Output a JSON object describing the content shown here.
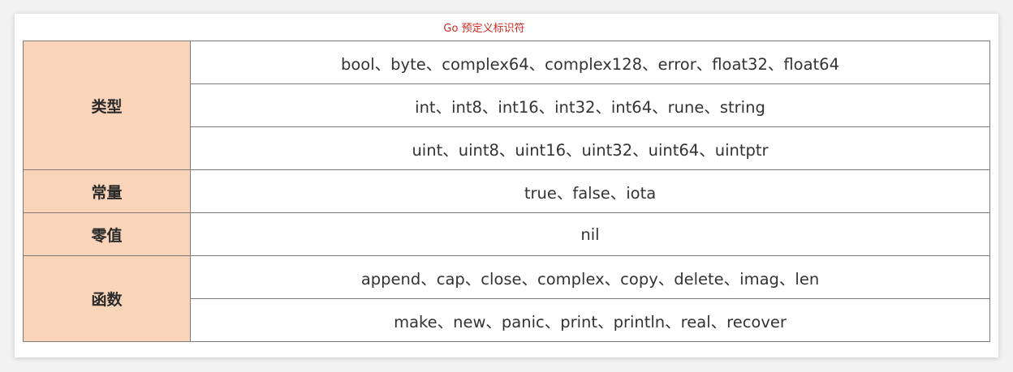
{
  "caption": "Go 预定义标识符",
  "table": {
    "groups": [
      {
        "category": "类型",
        "rows": [
          "bool、byte、complex64、complex128、error、float32、float64",
          "int、int8、int16、int32、int64、rune、string",
          "uint、uint8、uint16、uint32、uint64、uintptr"
        ]
      },
      {
        "category": "常量",
        "rows": [
          "true、false、iota"
        ]
      },
      {
        "category": "零值",
        "rows": [
          "nil"
        ]
      },
      {
        "category": "函数",
        "rows": [
          "append、cap、close、complex、copy、delete、imag、len",
          "make、new、panic、print、println、real、recover"
        ]
      }
    ]
  },
  "colors": {
    "category_bg": "#f9d4b8",
    "caption": "#d0281e",
    "border": "#7a7a7a"
  }
}
